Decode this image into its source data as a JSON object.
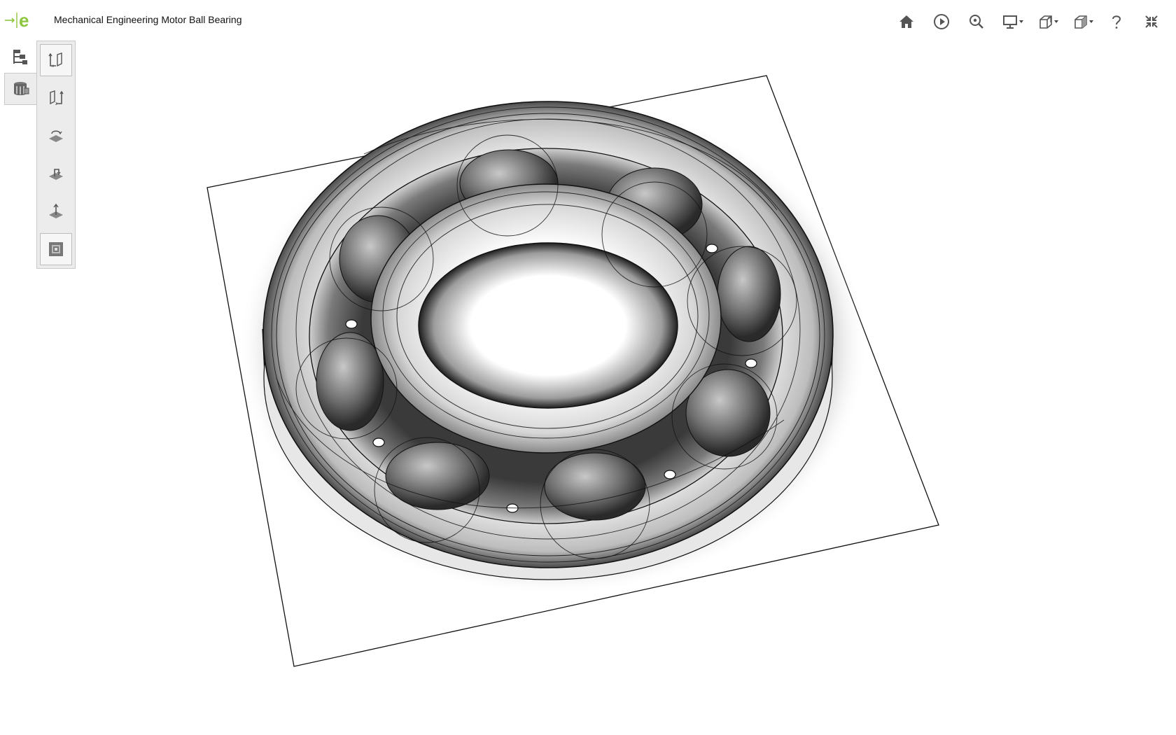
{
  "app": {
    "logo": "e",
    "title": "Mechanical Engineering Motor Ball Bearing"
  },
  "toolbar": [
    {
      "icon": "home-icon"
    },
    {
      "icon": "play-icon"
    },
    {
      "icon": "zoom-search-icon"
    },
    {
      "icon": "display-monitor-icon",
      "dropdown": true
    },
    {
      "icon": "section-view-icon",
      "dropdown": true
    },
    {
      "icon": "view-cube-icon",
      "dropdown": true
    },
    {
      "icon": "help-icon"
    },
    {
      "icon": "collapse-icon"
    }
  ],
  "left_tabs": [
    {
      "icon": "model-tree-icon",
      "active": false
    },
    {
      "icon": "views-icon",
      "active": true
    }
  ],
  "view_buttons": [
    {
      "icon": "view-front-icon",
      "selected": true
    },
    {
      "icon": "view-back-icon",
      "selected": false
    },
    {
      "icon": "view-top-icon",
      "selected": false
    },
    {
      "icon": "view-side-icon",
      "selected": false
    },
    {
      "icon": "view-bottom-icon",
      "selected": false
    },
    {
      "icon": "view-isometric-icon",
      "selected": true
    }
  ],
  "model": {
    "name": "ball-bearing",
    "ball_count": 8,
    "colors": {
      "line": "#111111",
      "shadow": "#2b2b2b",
      "face": "#ffffff"
    }
  },
  "colors": {
    "accent": "#8dc63f",
    "panel_bg": "#ececec",
    "panel_border": "#c9c9c9",
    "icon": "#555555"
  }
}
